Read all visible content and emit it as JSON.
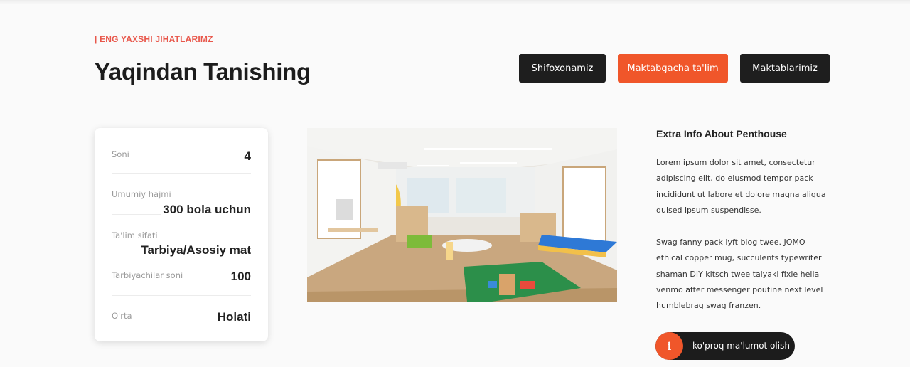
{
  "section": {
    "eyebrow": "| ENG YAXSHI JIHATLARIMZ",
    "title": "Yaqindan Tanishing"
  },
  "tabs": [
    {
      "label": "Shifoxonamiz",
      "active": false
    },
    {
      "label": "Maktabgacha ta'lim",
      "active": true
    },
    {
      "label": "Maktablarimiz",
      "active": false
    }
  ],
  "stats": [
    {
      "label": "Soni",
      "value": "4"
    },
    {
      "label": "Umumiy hajmi",
      "value": "300 bola uchun"
    },
    {
      "label": "Ta'lim sifati",
      "value": "Tarbiya/Asosiy mat"
    },
    {
      "label": "Tarbiyachilar soni",
      "value": "100"
    },
    {
      "label": "O'rta",
      "value": "Holati"
    }
  ],
  "image": {
    "subject": "kindergarten classroom photo"
  },
  "extra": {
    "title": "Extra Info About Penthouse",
    "paragraphs": [
      "Lorem ipsum dolor sit amet, consectetur adipiscing elit, do eiusmod tempor pack incididunt ut labore et dolore magna aliqua quised ipsum suspendisse.",
      "Swag fanny pack lyft blog twee. JOMO ethical copper mug, succulents typewriter shaman DIY kitsch twee taiyaki fixie hella venmo after messenger poutine next level humblebrag swag franzen."
    ],
    "button_label": "ko'proq ma'lumot olish",
    "button_icon": "i"
  },
  "colors": {
    "accent": "#f0562a",
    "dark": "#1e1e1e",
    "eyebrow": "#e8574b"
  }
}
